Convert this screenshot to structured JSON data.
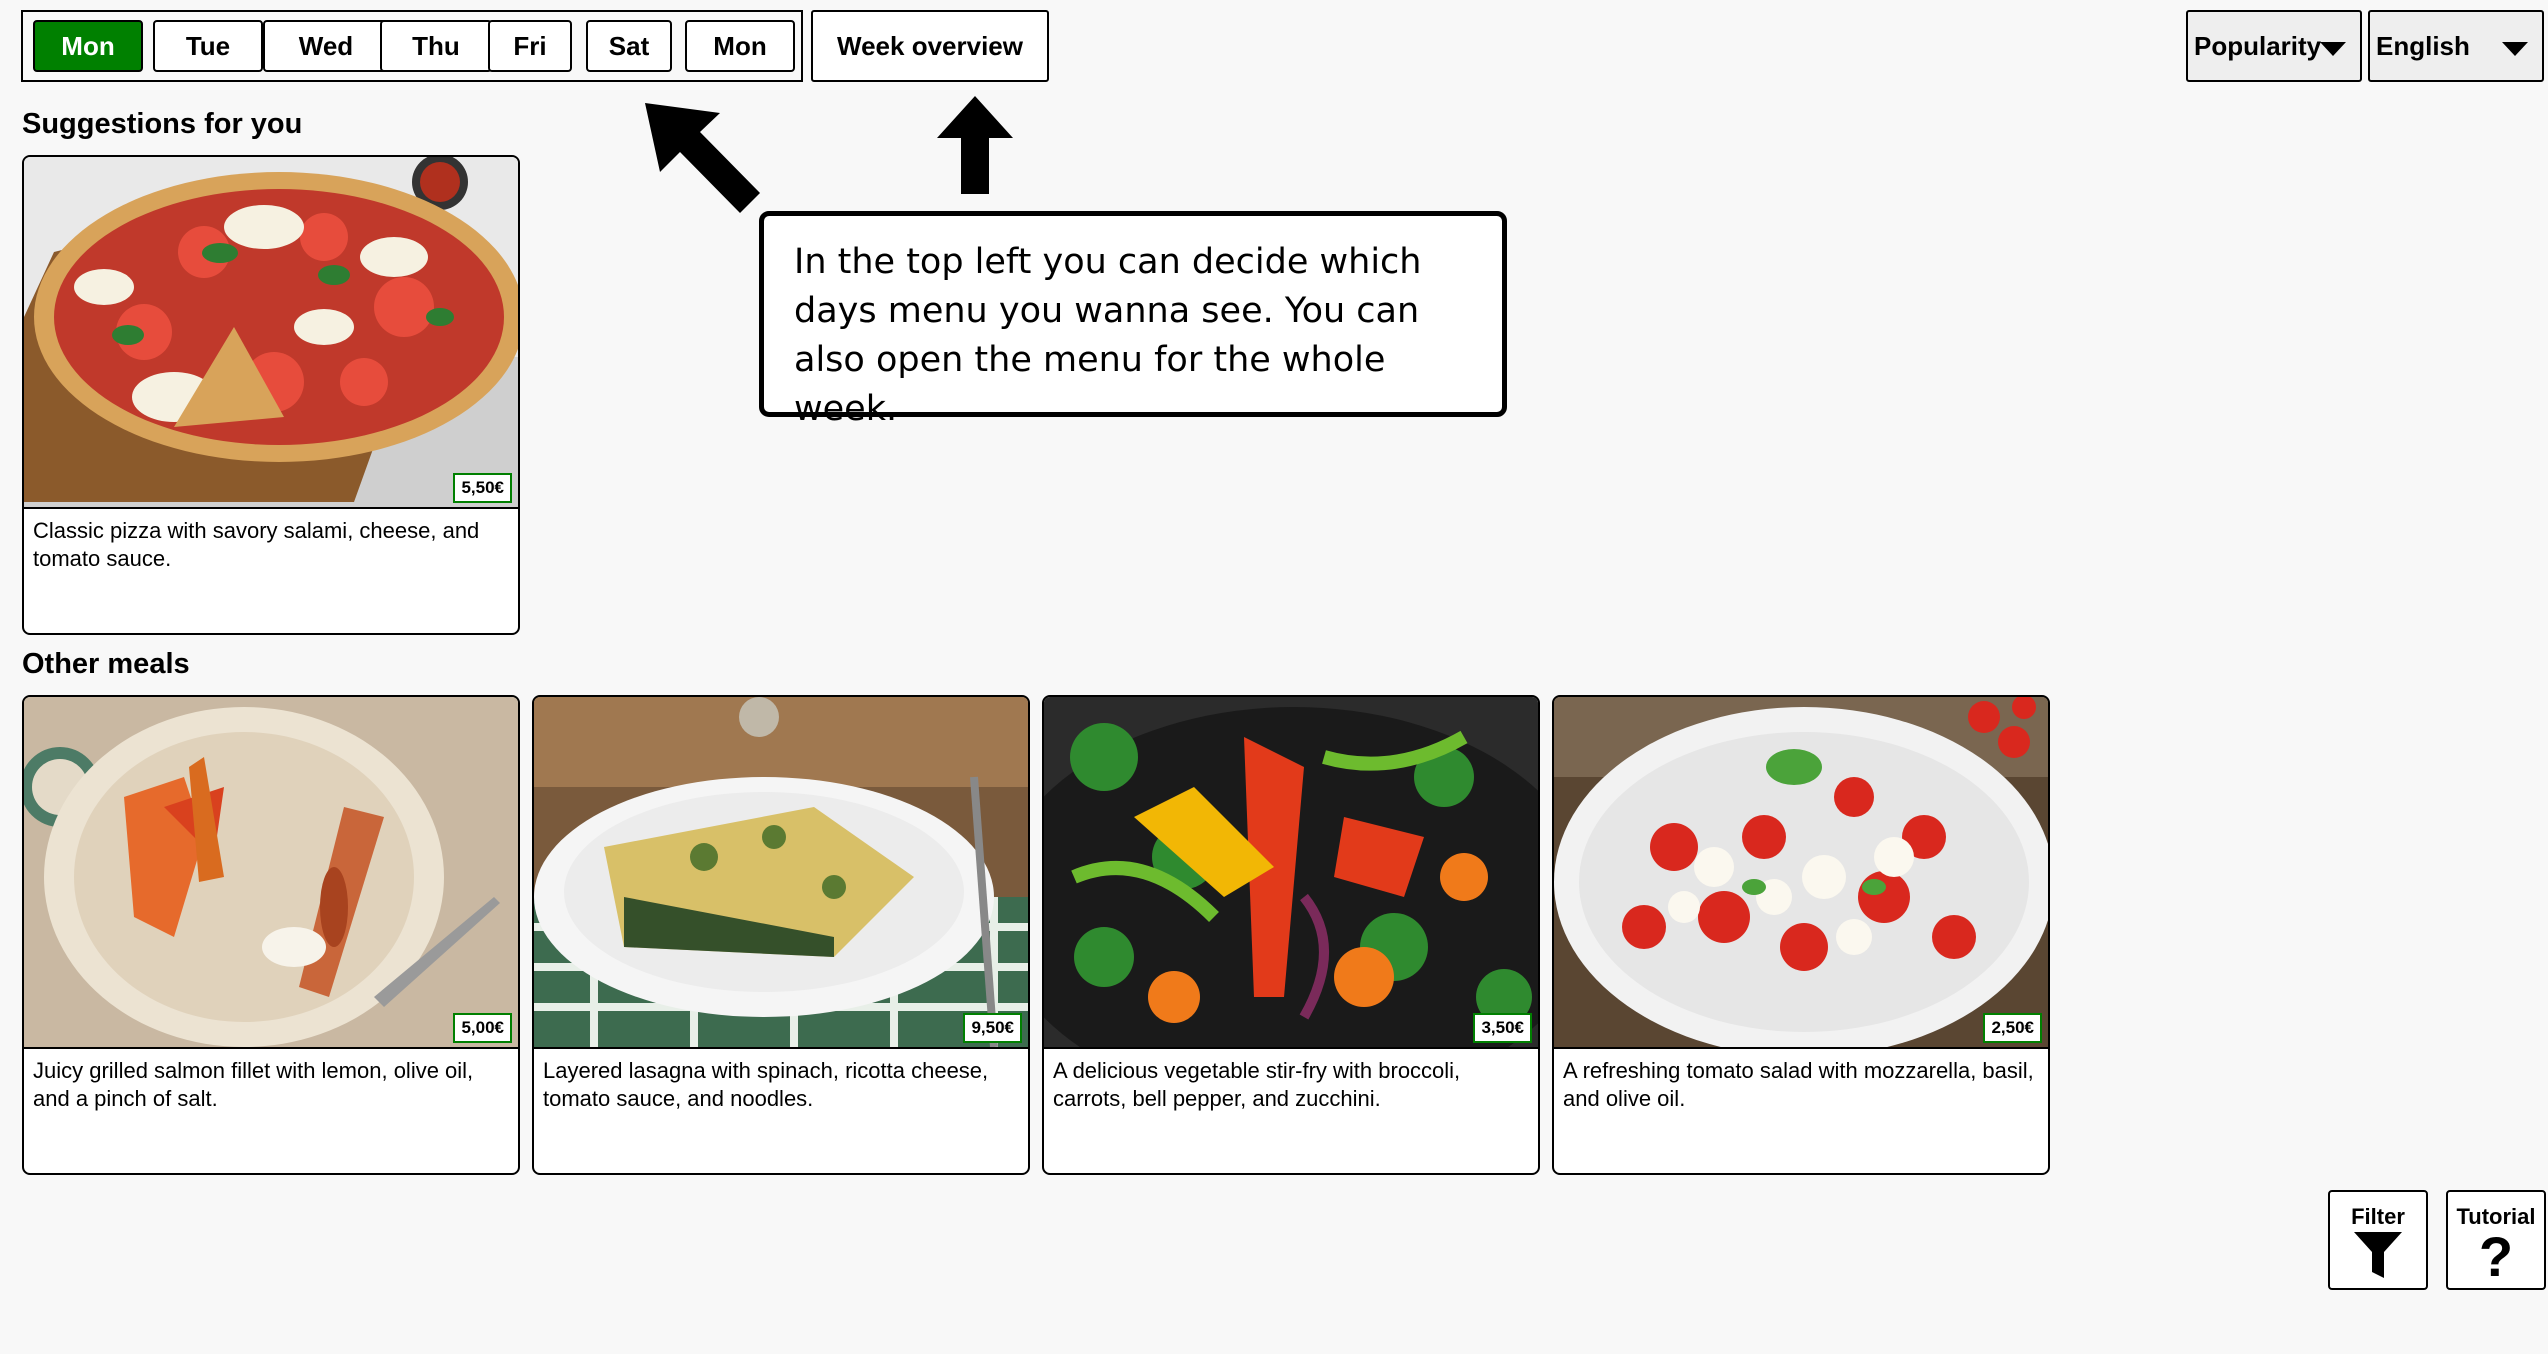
{
  "days": {
    "items": [
      {
        "label": "Mon",
        "active": true
      },
      {
        "label": "Tue",
        "active": false
      },
      {
        "label": "Wed",
        "active": false
      },
      {
        "label": "Thu",
        "active": false
      },
      {
        "label": "Fri",
        "active": false
      },
      {
        "label": "Sat",
        "active": false
      },
      {
        "label": "Mon",
        "active": false
      }
    ],
    "week_overview": "Week overview"
  },
  "sort": {
    "selected": "Popularity"
  },
  "language": {
    "selected": "English"
  },
  "suggestions": {
    "title": "Suggestions for you",
    "meals": [
      {
        "price": "5,50€",
        "description": "Classic pizza with savory salami, cheese, and tomato sauce.",
        "image": "pizza"
      }
    ]
  },
  "other": {
    "title": "Other meals",
    "meals": [
      {
        "price": "5,00€",
        "description": "Juicy grilled salmon fillet with lemon, olive oil, and a pinch of salt.",
        "image": "salmon"
      },
      {
        "price": "9,50€",
        "description": "Layered lasagna with spinach, ricotta cheese, tomato sauce, and noodles.",
        "image": "lasagna"
      },
      {
        "price": "3,50€",
        "description": "A delicious vegetable stir-fry with broccoli, carrots, bell pepper, and zucchini.",
        "image": "stirfry"
      },
      {
        "price": "2,50€",
        "description": "A refreshing tomato salad with mozzarella, basil, and olive oil.",
        "image": "salad"
      }
    ]
  },
  "tutorial_tip": {
    "text": "In the top left you can decide which days menu you wanna see. You can also open the menu for the whole week."
  },
  "corner": {
    "filter": "Filter",
    "tutorial": "Tutorial"
  },
  "colors": {
    "active_day": "#008000",
    "price_border": "#008000",
    "background": "#f8f8f8"
  }
}
